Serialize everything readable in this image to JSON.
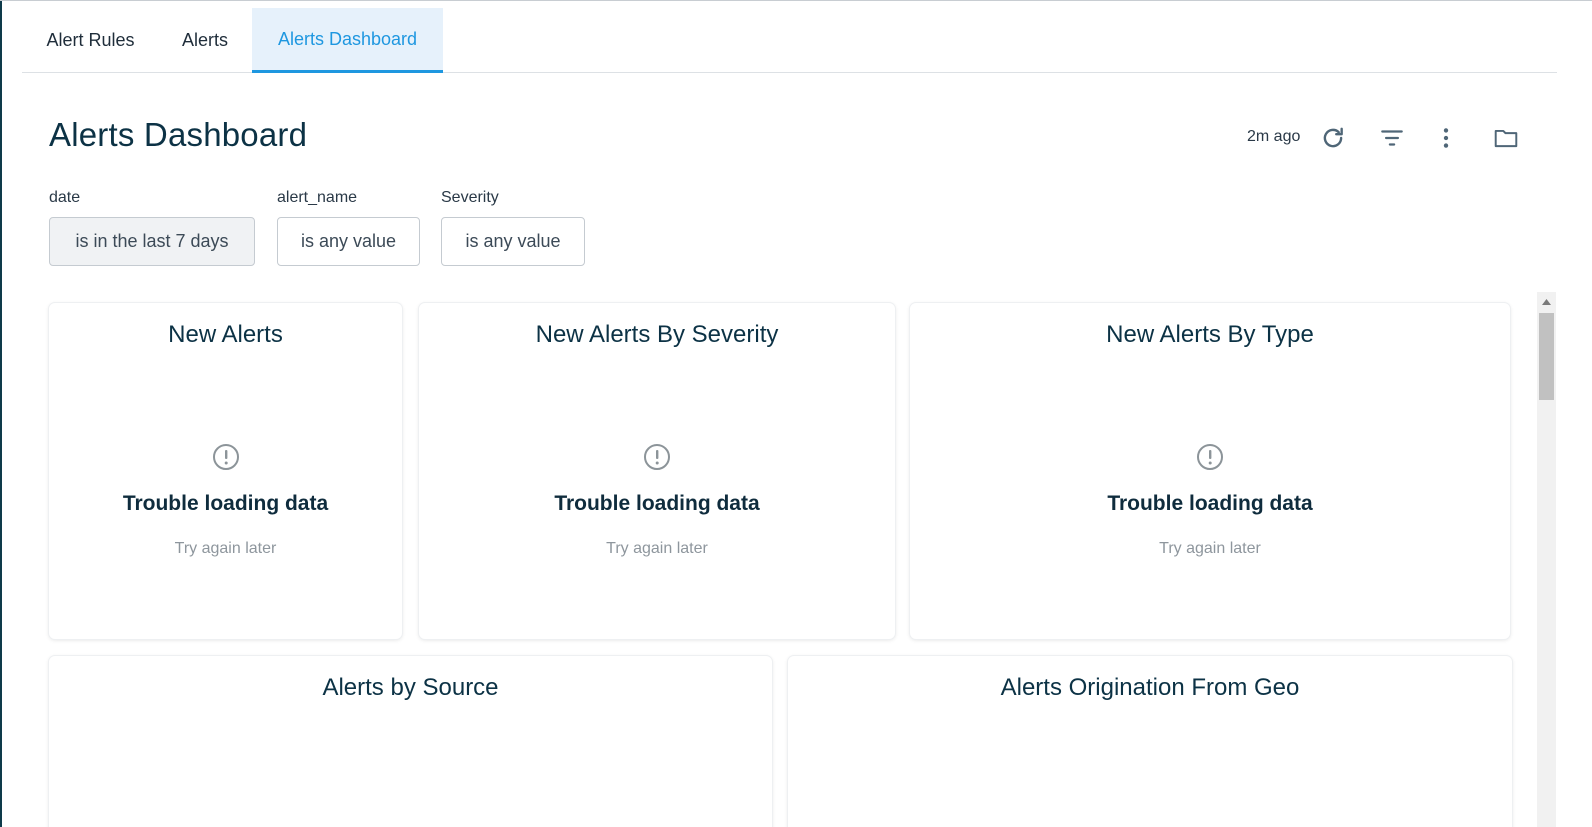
{
  "tabs": [
    {
      "label": "Alert Rules",
      "active": false
    },
    {
      "label": "Alerts",
      "active": false
    },
    {
      "label": "Alerts Dashboard",
      "active": true
    }
  ],
  "header": {
    "title": "Alerts Dashboard",
    "updated": "2m ago",
    "actions": [
      "refresh-icon",
      "filter-icon",
      "more-vertical-icon",
      "folder-icon"
    ]
  },
  "filters": [
    {
      "label": "date",
      "value": "is in the last 7 days"
    },
    {
      "label": "alert_name",
      "value": "is any value"
    },
    {
      "label": "Severity",
      "value": "is any value"
    }
  ],
  "tiles": [
    {
      "title": "New Alerts",
      "error_title": "Trouble loading data",
      "error_subtitle": "Try again later"
    },
    {
      "title": "New Alerts By Severity",
      "error_title": "Trouble loading data",
      "error_subtitle": "Try again later"
    },
    {
      "title": "New Alerts By Type",
      "error_title": "Trouble loading data",
      "error_subtitle": "Try again later"
    },
    {
      "title": "Alerts by Source"
    },
    {
      "title": "Alerts Origination From Geo"
    }
  ],
  "colors": {
    "accent": "#1e97e0",
    "active_tab_bg": "#e6f1fb",
    "title": "#0c3245",
    "muted": "#8e969d"
  }
}
